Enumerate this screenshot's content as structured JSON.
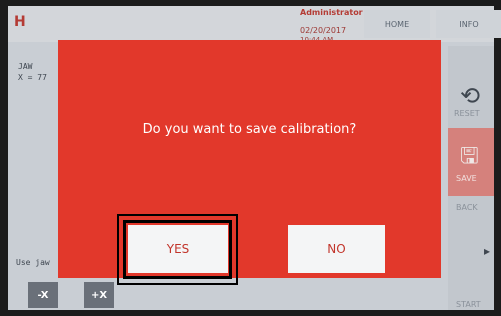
{
  "header": {
    "logo": "H",
    "user": "Administrator",
    "date": "02/20/2017",
    "time": "10:44 AM",
    "home_tab": "HOME",
    "info_tab": "INFO"
  },
  "left": {
    "jaw": "JAW",
    "x_value": "X = 77",
    "use_jaw": "Use jaw",
    "minus_x": "-X",
    "plus_x": "+X"
  },
  "sidebar": {
    "reset": "RESET",
    "save": "SAVE",
    "back": "BACK",
    "start": "START"
  },
  "dialog": {
    "message": "Do you want to save calibration?",
    "yes": "YES",
    "no": "NO"
  },
  "colors": {
    "modal_bg": "#e2382b",
    "button_bg": "#f4f5f6",
    "button_text": "#c2352b"
  },
  "icons": {
    "reset": "reset-arrow-icon",
    "save": "floppy-disk-icon",
    "next": "chevron-right-icon"
  }
}
